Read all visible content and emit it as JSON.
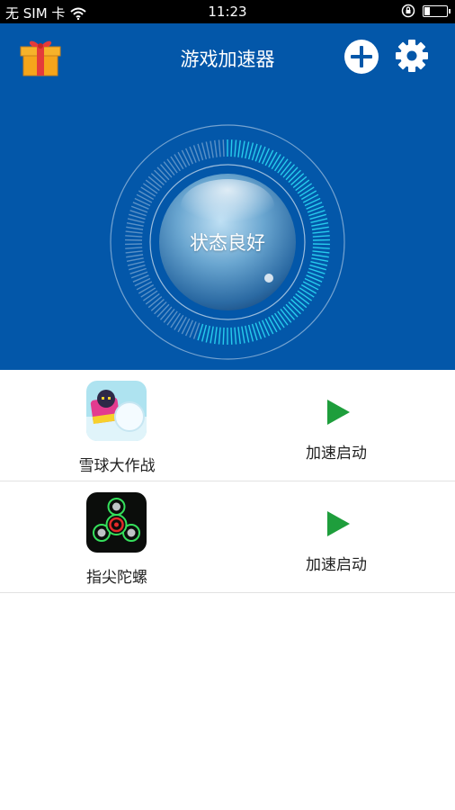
{
  "status_bar": {
    "carrier": "无 SIM 卡",
    "time": "11:23",
    "battery_level": 0.25
  },
  "header": {
    "title": "游戏加速器",
    "icons": [
      "gift-icon",
      "plus-circle-icon",
      "gear-icon"
    ]
  },
  "status_orb": {
    "text": "状态良好",
    "progress": 0.55
  },
  "games": [
    {
      "name": "雪球大作战",
      "action_label": "加速启动",
      "icon": "snowball-game-icon"
    },
    {
      "name": "指尖陀螺",
      "action_label": "加速启动",
      "icon": "fidget-spinner-icon"
    }
  ],
  "colors": {
    "primary": "#0357a9",
    "accent_cyan": "#28d3f0",
    "play_green": "#1e9e3c"
  }
}
